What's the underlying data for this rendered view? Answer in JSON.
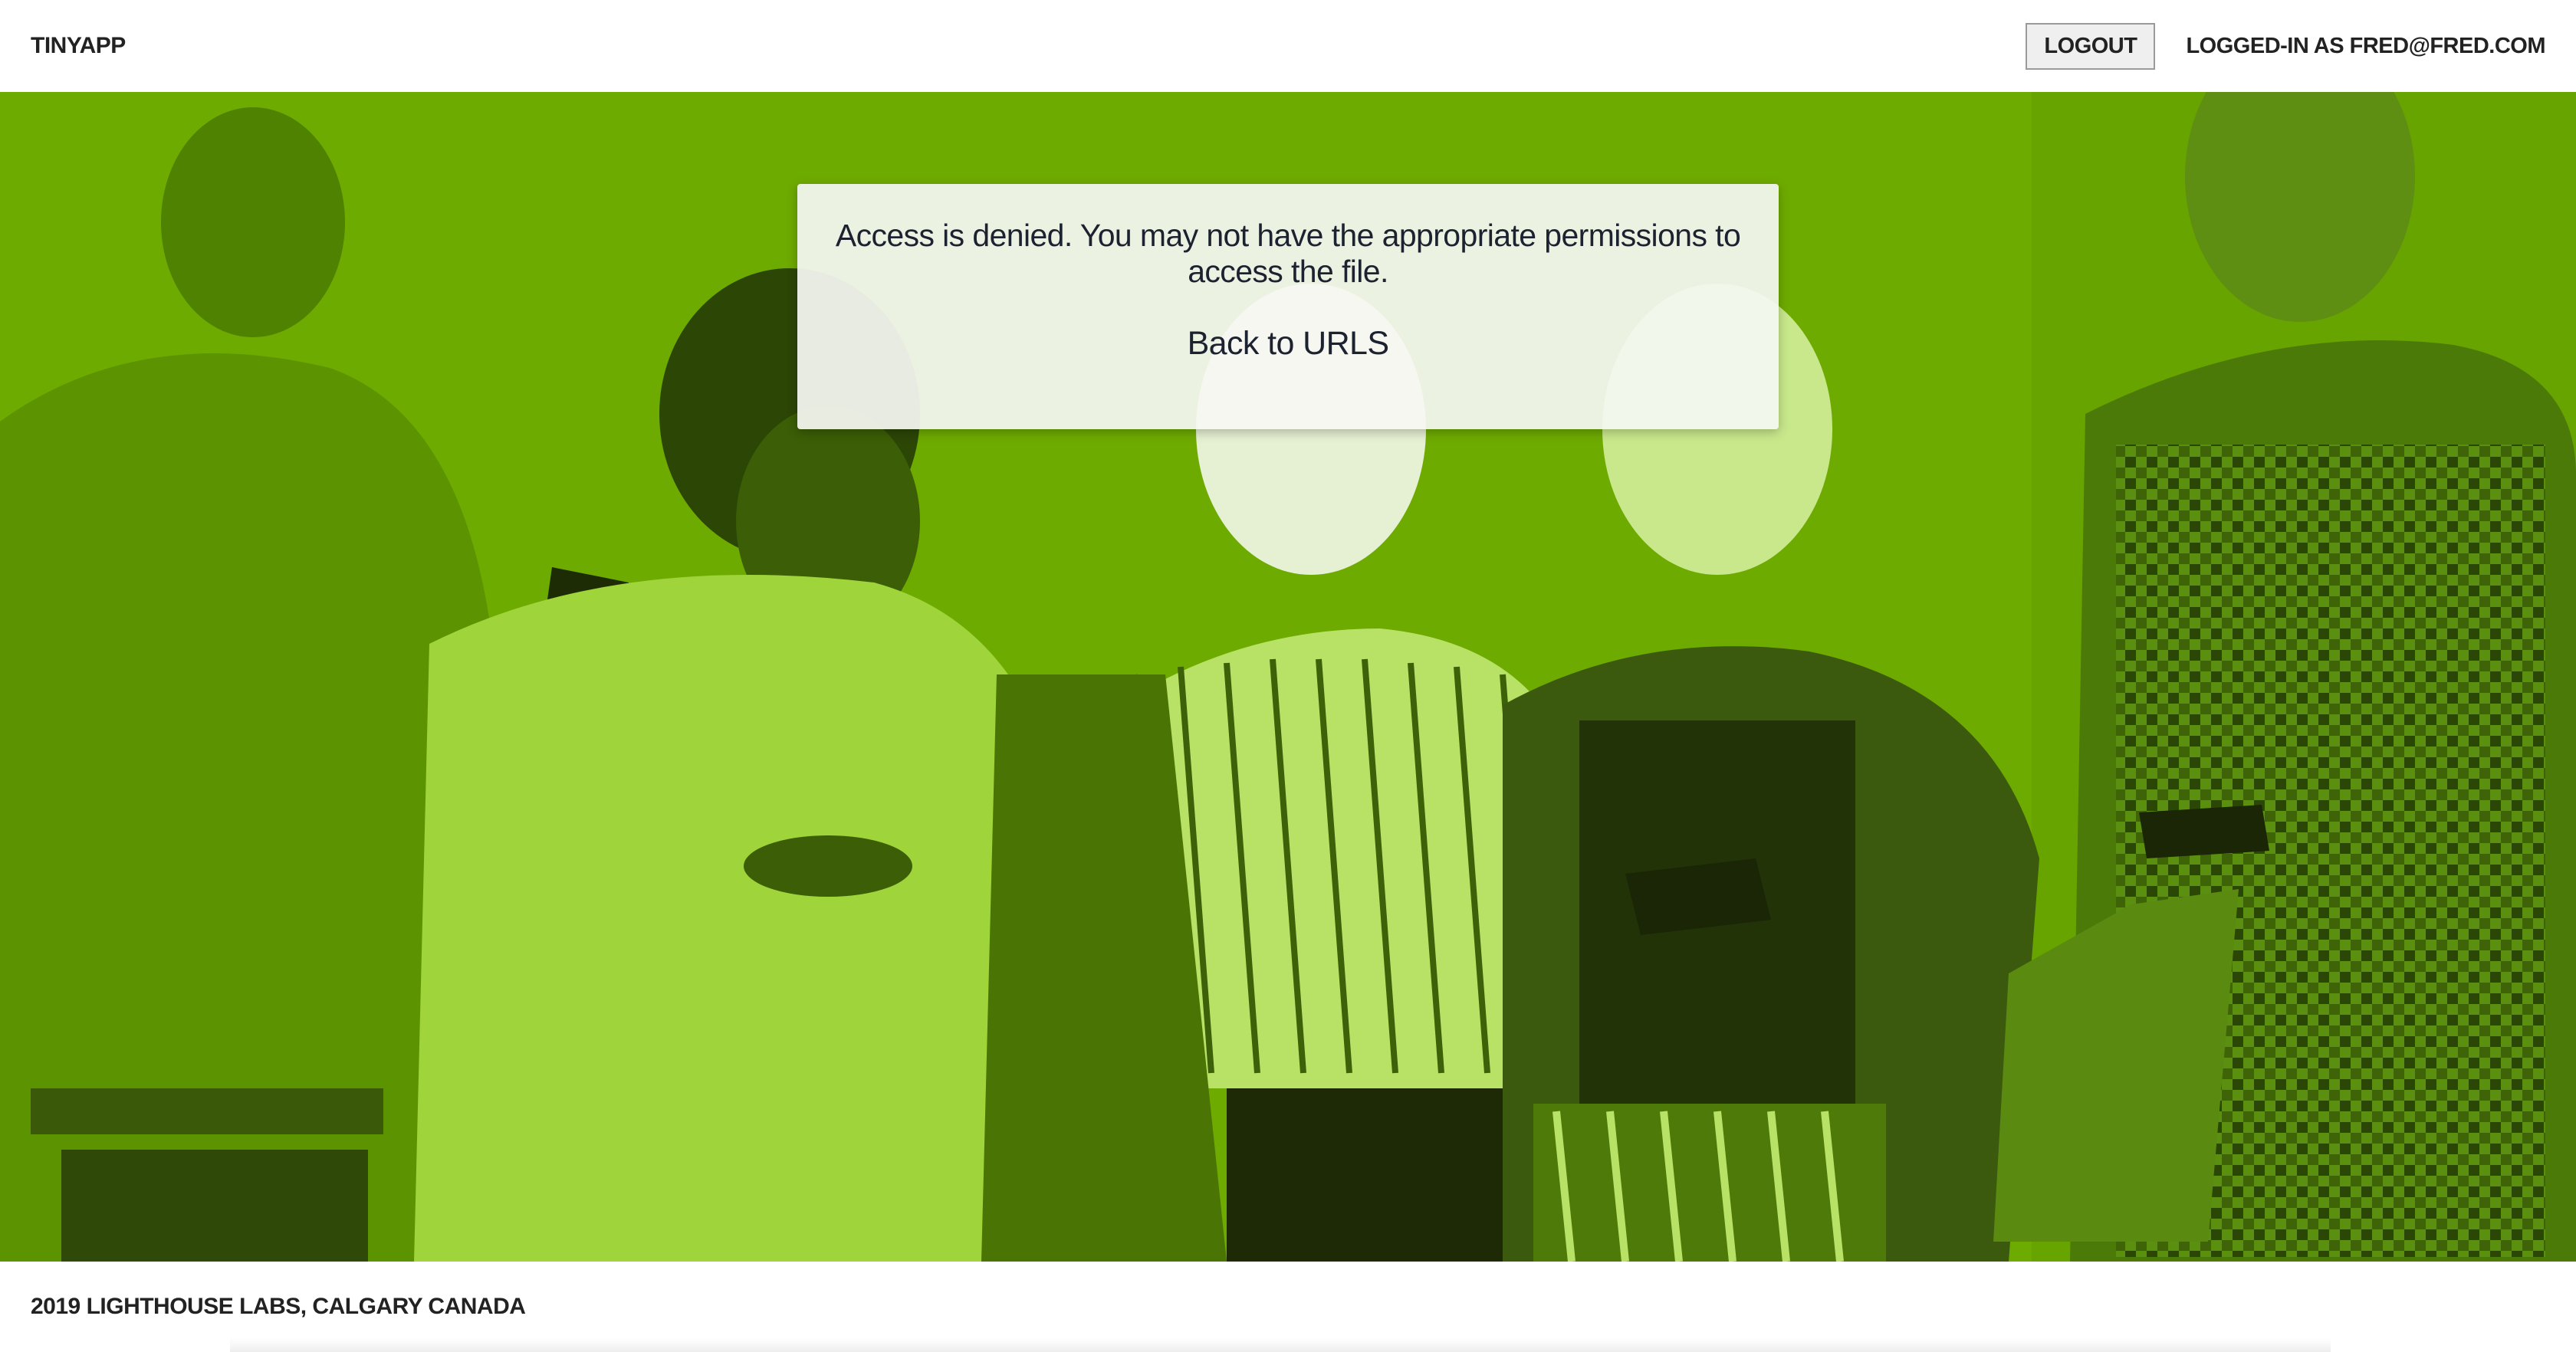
{
  "header": {
    "brand": "TINYAPP",
    "logout_label": "LOGOUT",
    "logged_in_text": "LOGGED-IN AS FRED@FRED.COM"
  },
  "panel": {
    "message": "Access is denied. You may not have the appropriate permissions to access the file.",
    "back_link": "Back to URLS"
  },
  "footer": {
    "text": "2019 LIGHTHOUSE LABS, CALGARY CANADA"
  },
  "colors": {
    "hero_green": "#6aa800",
    "panel_bg": "#f5f7f2",
    "text_dark": "#1c2230"
  }
}
